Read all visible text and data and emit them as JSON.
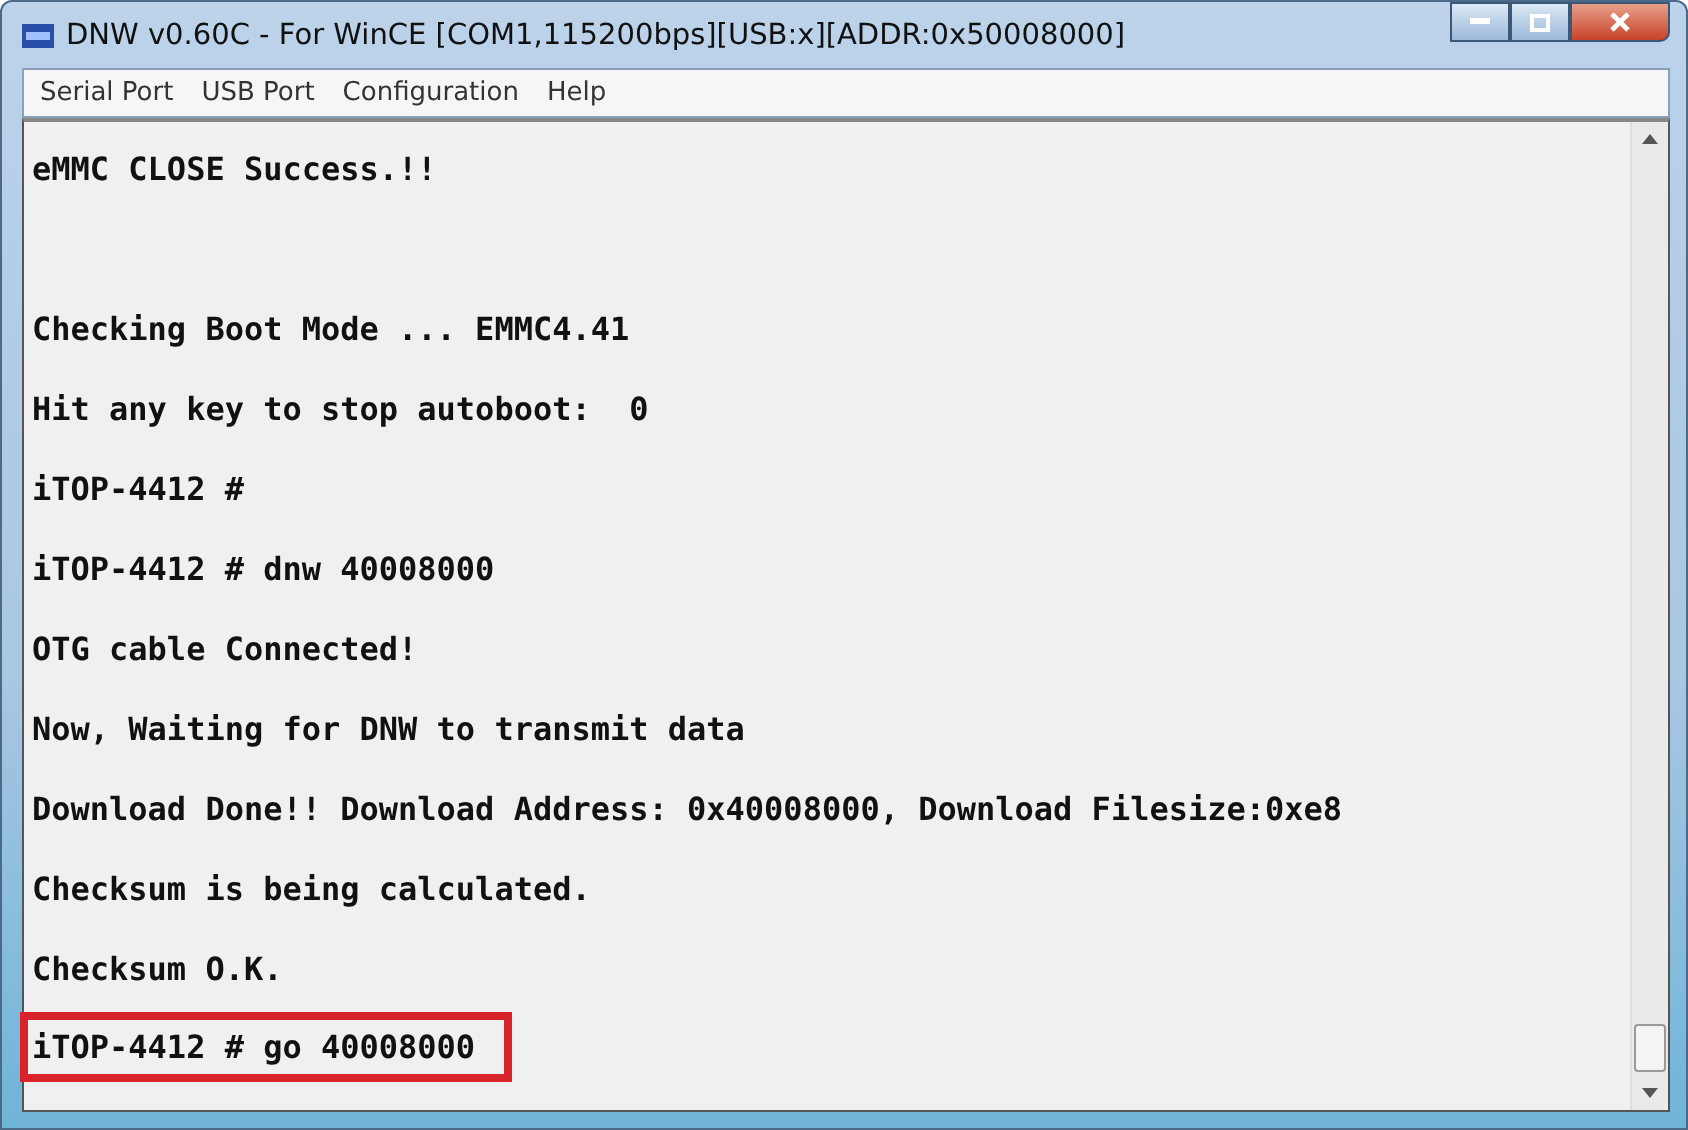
{
  "window": {
    "title": "DNW v0.60C - For WinCE   [COM1,115200bps][USB:x][ADDR:0x50008000]"
  },
  "menu": [
    {
      "label": "Serial Port"
    },
    {
      "label": "USB Port"
    },
    {
      "label": "Configuration"
    },
    {
      "label": "Help"
    }
  ],
  "console": {
    "lines": [
      {
        "text": "eMMC CLOSE Success.!!",
        "highlighted": false
      },
      {
        "text": "Checking Boot Mode ... EMMC4.41",
        "highlighted": false
      },
      {
        "text": "Hit any key to stop autoboot:  0",
        "highlighted": false
      },
      {
        "text": "iTOP-4412 #",
        "highlighted": false
      },
      {
        "text": "iTOP-4412 # dnw 40008000",
        "highlighted": false
      },
      {
        "text": "OTG cable Connected!",
        "highlighted": false
      },
      {
        "text": "Now, Waiting for DNW to transmit data",
        "highlighted": false
      },
      {
        "text": "Download Done!! Download Address: 0x40008000, Download Filesize:0xe8",
        "highlighted": false
      },
      {
        "text": "Checksum is being calculated.",
        "highlighted": false
      },
      {
        "text": "Checksum O.K.",
        "highlighted": false
      },
      {
        "text": "iTOP-4412 # go 40008000",
        "highlighted": true
      }
    ]
  }
}
